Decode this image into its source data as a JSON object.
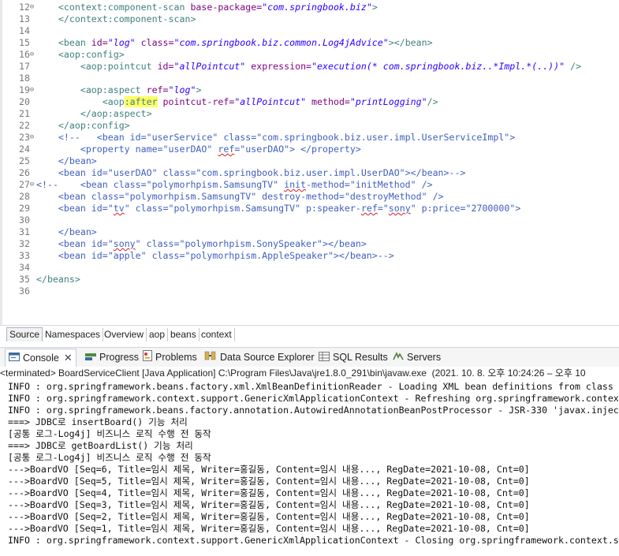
{
  "editor": {
    "lines": [
      {
        "n": "12",
        "fold": "⊖",
        "segs": [
          [
            "    ",
            "t"
          ],
          [
            "<context:component-scan",
            "tag"
          ],
          [
            " base-package=",
            "attr"
          ],
          [
            "\"com.springbook.biz\"",
            "val"
          ],
          [
            ">",
            "tag"
          ]
        ]
      },
      {
        "n": "13",
        "fold": "",
        "segs": [
          [
            "    ",
            "t"
          ],
          [
            "</context:component-scan>",
            "tag"
          ]
        ]
      },
      {
        "n": "14",
        "fold": "",
        "segs": []
      },
      {
        "n": "15",
        "fold": "",
        "segs": [
          [
            "    ",
            "t"
          ],
          [
            "<bean",
            "tag"
          ],
          [
            " id=",
            "attr"
          ],
          [
            "\"log\"",
            "val"
          ],
          [
            " class=",
            "attr"
          ],
          [
            "\"com.springbook.biz.common.Log4jAdvice\"",
            "val"
          ],
          [
            "></bean>",
            "tag"
          ]
        ]
      },
      {
        "n": "16",
        "fold": "⊖",
        "segs": [
          [
            "    ",
            "t"
          ],
          [
            "<aop:config>",
            "tag"
          ]
        ]
      },
      {
        "n": "17",
        "fold": "",
        "segs": [
          [
            "        ",
            "t"
          ],
          [
            "<aop:pointcut",
            "tag"
          ],
          [
            " id=",
            "attr"
          ],
          [
            "\"allPointcut\"",
            "val"
          ],
          [
            " expression=",
            "attr"
          ],
          [
            "\"execution(* com.springbook.biz..*Impl.*(..))\"",
            "val"
          ],
          [
            " />",
            "tag"
          ]
        ]
      },
      {
        "n": "18",
        "fold": "",
        "segs": []
      },
      {
        "n": "19",
        "fold": "⊖",
        "segs": [
          [
            "        ",
            "t"
          ],
          [
            "<aop:aspect",
            "tag"
          ],
          [
            " ref=",
            "attr"
          ],
          [
            "\"log\"",
            "val"
          ],
          [
            ">",
            "tag"
          ]
        ]
      },
      {
        "n": "20",
        "fold": "",
        "segs": [
          [
            "            ",
            "t"
          ],
          [
            "<aop",
            "tag"
          ],
          [
            ":after",
            "hl"
          ],
          [
            " pointcut-ref=",
            "attr"
          ],
          [
            "\"allPointcut\"",
            "val"
          ],
          [
            " method=",
            "attr"
          ],
          [
            "\"printLogging\"",
            "val"
          ],
          [
            "/>",
            "tag"
          ]
        ]
      },
      {
        "n": "21",
        "fold": "",
        "segs": [
          [
            "        ",
            "t"
          ],
          [
            "</aop:aspect>",
            "tag"
          ]
        ]
      },
      {
        "n": "22",
        "fold": "",
        "segs": [
          [
            "    ",
            "t"
          ],
          [
            "</aop:config>",
            "tag"
          ]
        ]
      },
      {
        "n": "23",
        "fold": "⊖",
        "segs": [
          [
            "    ",
            "t"
          ],
          [
            "<!--   <bean id=\"userService\" class=\"com.springbook.biz.user.impl.UserServiceImpl\">",
            "cmt"
          ]
        ]
      },
      {
        "n": "24",
        "fold": "",
        "segs": [
          [
            "        ",
            "t"
          ],
          [
            "<property name=\"userDAO\" ",
            "cmt"
          ],
          [
            "ref",
            "cmtsq"
          ],
          [
            "=\"userDAO\"> </property>",
            "cmt"
          ]
        ]
      },
      {
        "n": "25",
        "fold": "",
        "segs": [
          [
            "    ",
            "t"
          ],
          [
            "</bean>",
            "cmt"
          ]
        ]
      },
      {
        "n": "26",
        "fold": "",
        "segs": [
          [
            "    ",
            "t"
          ],
          [
            "<bean id=\"userDAO\" class=\"com.springbook.biz.user.impl.UserDAO\"></bean>-->",
            "cmt"
          ]
        ]
      },
      {
        "n": "27",
        "fold": "⊖",
        "segs": [
          [
            "<!--    <bean class=\"polymorhpism.SamsungTV\" ",
            "cmt"
          ],
          [
            "init",
            "cmtsq"
          ],
          [
            "-method=\"initMethod\" />",
            "cmt"
          ]
        ]
      },
      {
        "n": "28",
        "fold": "",
        "segs": [
          [
            "    ",
            "t"
          ],
          [
            "<bean class=\"polymorhpism.SamsungTV\" destroy-method=\"destroyMethod\" />",
            "cmt"
          ]
        ]
      },
      {
        "n": "29",
        "fold": "",
        "segs": [
          [
            "    ",
            "t"
          ],
          [
            "<bean id=\"",
            "cmt"
          ],
          [
            "tv",
            "cmtsq"
          ],
          [
            "\" class=\"polymorhpism.SamsungTV\" p:speaker-",
            "cmt"
          ],
          [
            "ref",
            "cmtsq"
          ],
          [
            "=\"",
            "cmt"
          ],
          [
            "sony",
            "cmtsq"
          ],
          [
            "\" p:price=\"2700000\">",
            "cmt"
          ]
        ]
      },
      {
        "n": "30",
        "fold": "",
        "segs": []
      },
      {
        "n": "31",
        "fold": "",
        "segs": [
          [
            "    ",
            "t"
          ],
          [
            "</bean>",
            "cmt"
          ]
        ]
      },
      {
        "n": "32",
        "fold": "",
        "segs": [
          [
            "    ",
            "t"
          ],
          [
            "<bean id=\"",
            "cmt"
          ],
          [
            "sony",
            "cmtsq"
          ],
          [
            "\" class=\"polymorhpism.SonySpeaker\"></bean>",
            "cmt"
          ]
        ]
      },
      {
        "n": "33",
        "fold": "",
        "segs": [
          [
            "    ",
            "t"
          ],
          [
            "<bean id=\"apple\" class=\"polymorhpism.AppleSpeaker\"></bean>-->",
            "cmt"
          ]
        ]
      },
      {
        "n": "34",
        "fold": "",
        "segs": []
      },
      {
        "n": "35",
        "fold": "",
        "segs": [
          [
            "</beans>",
            "tag"
          ]
        ]
      },
      {
        "n": "36",
        "fold": "",
        "segs": []
      }
    ]
  },
  "editor_tabs": [
    "Source",
    "Namespaces",
    "Overview",
    "aop",
    "beans",
    "context"
  ],
  "editor_tabs_active": "Source",
  "views": {
    "console": "Console",
    "progress": "Progress",
    "problems": "Problems",
    "data_source_explorer": "Data Source Explorer",
    "sql_results": "SQL Results",
    "servers": "Servers"
  },
  "terminated": "<terminated> BoardServiceClient [Java Application] C:\\Program Files\\Java\\jre1.8.0_291\\bin\\javaw.exe  (2021. 10. 8. 오후 10:24:26 – 오후 10",
  "console_lines": [
    "INFO : org.springframework.beans.factory.xml.XmlBeanDefinitionReader - Loading XML bean definitions from class",
    "INFO : org.springframework.context.support.GenericXmlApplicationContext - Refreshing org.springframework.contex",
    "INFO : org.springframework.beans.factory.annotation.AutowiredAnnotationBeanPostProcessor - JSR-330 'javax.injec",
    "===> JDBC로 insertBoard() 기능 처리",
    "[공통 로그-Log4j] 비즈니스 로직 수행 전 동작",
    "===> JDBC로 getBoardList() 기능 처리",
    "[공통 로그-Log4j] 비즈니스 로직 수행 전 동작",
    "--->BoardVO [Seq=6, Title=임시 제목, Writer=홍길동, Content=임시 내용..., RegDate=2021-10-08, Cnt=0]",
    "--->BoardVO [Seq=5, Title=임시 제목, Writer=홍길동, Content=임시 내용..., RegDate=2021-10-08, Cnt=0]",
    "--->BoardVO [Seq=4, Title=임시 제목, Writer=홍길동, Content=임시 내용..., RegDate=2021-10-08, Cnt=0]",
    "--->BoardVO [Seq=3, Title=임시 제목, Writer=홍길동, Content=임시 내용..., RegDate=2021-10-08, Cnt=0]",
    "--->BoardVO [Seq=2, Title=임시 제목, Writer=홍길동, Content=임시 내용..., RegDate=2021-10-08, Cnt=0]",
    "--->BoardVO [Seq=1, Title=임시 제목, Writer=홍길동, Content=임시 내용..., RegDate=2021-10-08, Cnt=0]",
    "INFO : org.springframework.context.support.GenericXmlApplicationContext - Closing org.springframework.context.s"
  ]
}
